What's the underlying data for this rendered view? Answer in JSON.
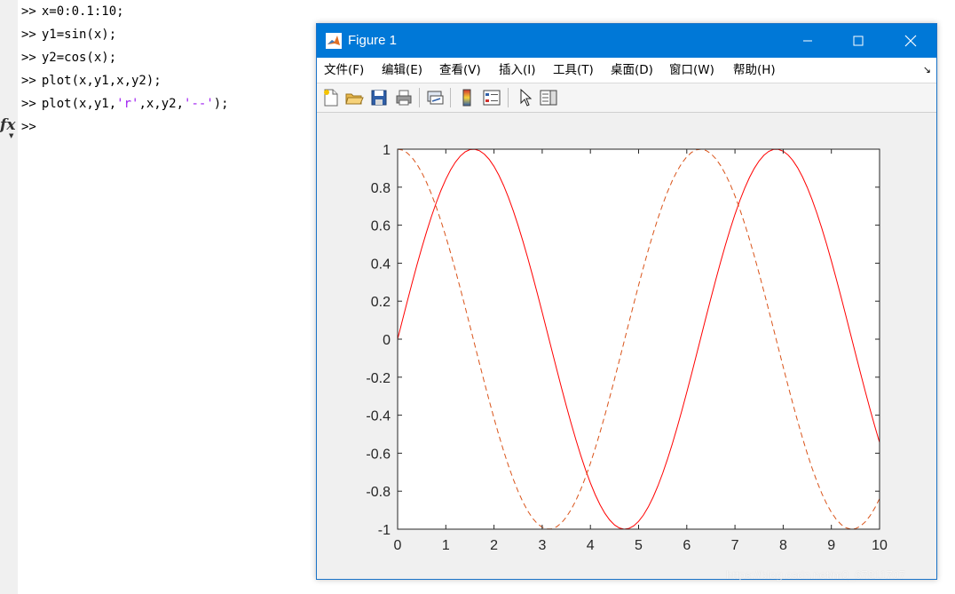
{
  "command_window": {
    "prompt": ">>",
    "lines": [
      {
        "code": "x=0:0.1:10;"
      },
      {
        "code": "y1=sin(x);"
      },
      {
        "code": "y2=cos(x);"
      },
      {
        "code": "plot(x,y1,x,y2);"
      },
      {
        "pre": "plot(x,y1,",
        "s1": "'r'",
        "mid": ",x,y2,",
        "s2": "'--'",
        "post": ");"
      },
      {
        "code": ""
      }
    ],
    "fx_label": "fx",
    "string_color": "#a020f0"
  },
  "figure": {
    "title": "Figure 1",
    "titlebar_color": "#0078d7",
    "menu": [
      "文件(F)",
      "编辑(E)",
      "查看(V)",
      "插入(I)",
      "工具(T)",
      "桌面(D)",
      "窗口(W)",
      "帮助(H)"
    ],
    "toolbar_icons": [
      "new-figure-icon",
      "open-file-icon",
      "save-icon",
      "print-icon",
      "link-plot-icon",
      "colorbar-icon",
      "legend-icon",
      "edit-plot-arrow-icon",
      "property-inspector-icon"
    ]
  },
  "chart_data": {
    "type": "line",
    "x_range": [
      0,
      10
    ],
    "step": 0.1,
    "xlim": [
      0,
      10
    ],
    "ylim": [
      -1,
      1
    ],
    "xticks": [
      "0",
      "1",
      "2",
      "3",
      "4",
      "5",
      "6",
      "7",
      "8",
      "9",
      "10"
    ],
    "yticks": [
      "1",
      "0.8",
      "0.6",
      "0.4",
      "0.2",
      "0",
      "-0.2",
      "-0.4",
      "-0.6",
      "-0.8",
      "-1"
    ],
    "series": [
      {
        "function": "sin",
        "color": "#ff0000",
        "style": "solid"
      },
      {
        "function": "cos",
        "color": "#d95319",
        "style": "dashed"
      }
    ],
    "grid": false
  },
  "watermark": "https://blog.csdn.net/m0_67811707"
}
